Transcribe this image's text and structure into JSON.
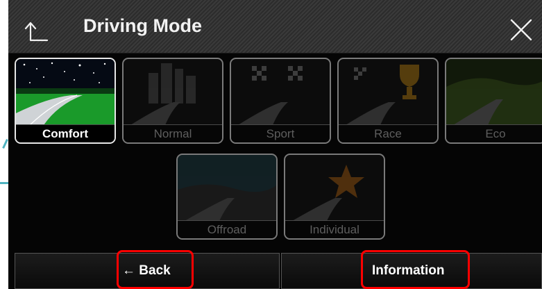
{
  "header": {
    "title": "Driving Mode",
    "back_icon": "up-arrow-icon",
    "close_icon": "close-icon"
  },
  "modes": [
    {
      "label": "Comfort",
      "selected": true
    },
    {
      "label": "Normal",
      "selected": false
    },
    {
      "label": "Sport",
      "selected": false
    },
    {
      "label": "Race",
      "selected": false
    },
    {
      "label": "Eco",
      "selected": false
    },
    {
      "label": "Offroad",
      "selected": false
    },
    {
      "label": "Individual",
      "selected": false
    }
  ],
  "footer": {
    "back_label": "← Back",
    "info_label": "Information"
  },
  "colors": {
    "highlight": "#ff0000",
    "accent_line": "#4fb3c0"
  }
}
